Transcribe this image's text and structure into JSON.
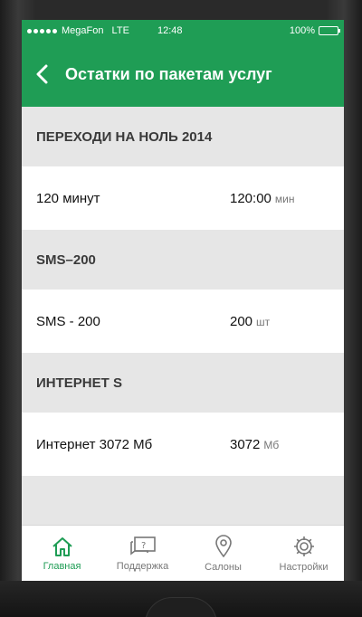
{
  "status_bar": {
    "carrier": "MegaFon",
    "network": "LTE",
    "time": "12:48",
    "battery": "100%"
  },
  "nav": {
    "title": "Остатки по пакетам услуг",
    "back_icon": "chevron-left-icon"
  },
  "sections": [
    {
      "header": "ПЕРЕХОДИ НА НОЛЬ 2014",
      "row_label": "120 минут",
      "value": "120:00",
      "unit": "мин"
    },
    {
      "header": "SMS–200",
      "row_label": "SMS - 200",
      "value": "200",
      "unit": "шт"
    },
    {
      "header": "ИНТЕРНЕТ S",
      "row_label": "Интернет 3072 Мб",
      "value": "3072",
      "unit": "Мб"
    }
  ],
  "tabs": [
    {
      "label": "Главная",
      "icon": "home-icon",
      "active": true
    },
    {
      "label": "Поддержка",
      "icon": "support-chat-icon",
      "active": false
    },
    {
      "label": "Салоны",
      "icon": "location-pin-icon",
      "active": false
    },
    {
      "label": "Настройки",
      "icon": "gear-icon",
      "active": false
    }
  ],
  "colors": {
    "brand": "#1f9d55",
    "tab_inactive": "#777777"
  }
}
